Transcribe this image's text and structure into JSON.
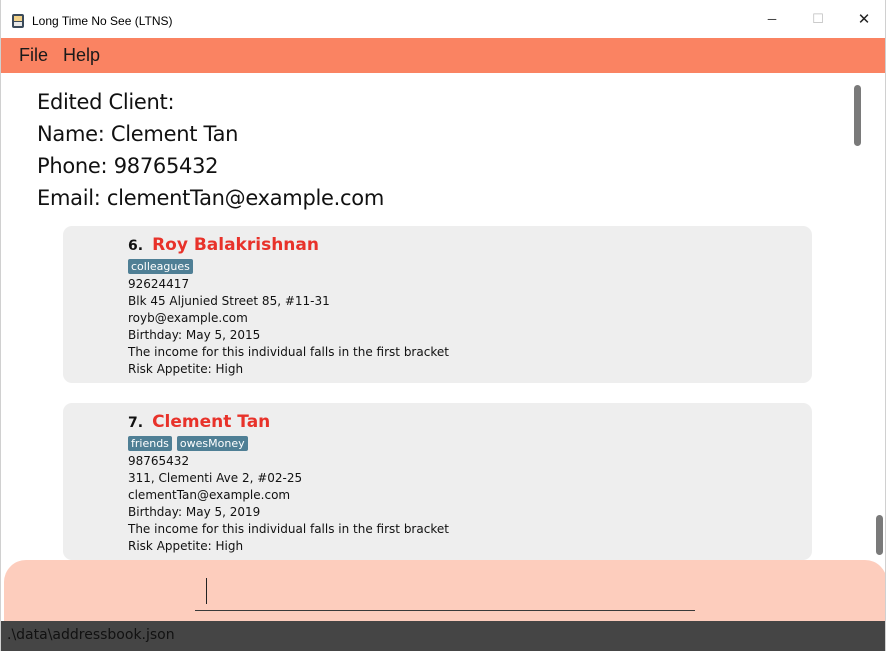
{
  "window": {
    "title": "Long Time No See (LTNS)",
    "minimize_glyph": "─",
    "maximize_glyph": "☐",
    "close_glyph": "✕"
  },
  "menu": {
    "items": [
      {
        "label": "File"
      },
      {
        "label": "Help"
      }
    ]
  },
  "result": {
    "lines": [
      "Edited Client:",
      "Name: Clement Tan",
      "Phone: 98765432",
      "Email: clementTan@example.com"
    ]
  },
  "clients": [
    {
      "index": "6.",
      "name": "Roy Balakrishnan",
      "tags": [
        "colleagues"
      ],
      "phone": "92624417",
      "address": "Blk 45 Aljunied Street 85, #11-31",
      "email": "royb@example.com",
      "birthday": "Birthday: May 5, 2015",
      "income": "The income for this individual falls in the first bracket",
      "risk": "Risk Appetite: High"
    },
    {
      "index": "7.",
      "name": "Clement Tan",
      "tags": [
        "friends",
        "owesMoney"
      ],
      "phone": "98765432",
      "address": "311, Clementi Ave 2, #02-25",
      "email": "clementTan@example.com",
      "birthday": "Birthday: May 5, 2019",
      "income": "The income for this individual falls in the first bracket",
      "risk": "Risk Appetite: High"
    }
  ],
  "command": {
    "value": "",
    "placeholder": ""
  },
  "status": {
    "path": ".\\data\\addressbook.json"
  },
  "colors": {
    "menu_bar": "#fa8362",
    "command_area": "#fdcdbd",
    "name_text": "#e8322a",
    "tag_bg": "#4f7f95",
    "card_bg": "#eeeeee",
    "status_bar": "#454545"
  },
  "icons": {
    "app": "app-logo-icon"
  }
}
